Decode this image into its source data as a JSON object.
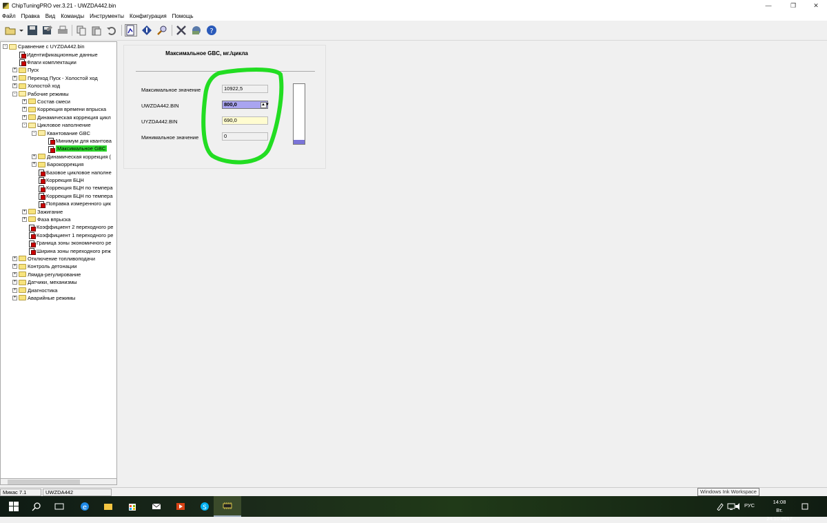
{
  "window": {
    "title": "ChipTuningPRO ver.3.21 - UWZDA442.bin"
  },
  "menu": [
    "Файл",
    "Правка",
    "Вид",
    "Команды",
    "Инструменты",
    "Конфигурация",
    "Помощь"
  ],
  "tree": {
    "nodes": [
      {
        "label": "Сравнение с UYZDA442.bin",
        "level": 0,
        "type": "folder-open",
        "expander": "-"
      },
      {
        "label": "Идентификационные данные",
        "level": 1,
        "type": "doc",
        "expander": ""
      },
      {
        "label": "Флаги комплектации",
        "level": 1,
        "type": "doc",
        "expander": ""
      },
      {
        "label": "Пуск",
        "level": 1,
        "type": "folder",
        "expander": "+"
      },
      {
        "label": "Переход Пуск - Холостой ход",
        "level": 1,
        "type": "folder",
        "expander": "+"
      },
      {
        "label": "Холостой ход",
        "level": 1,
        "type": "folder",
        "expander": "+"
      },
      {
        "label": "Рабочие режимы",
        "level": 1,
        "type": "folder-open",
        "expander": "-"
      },
      {
        "label": "Состав смеси",
        "level": 2,
        "type": "folder",
        "expander": "+"
      },
      {
        "label": "Коррекция времени впрыска",
        "level": 2,
        "type": "folder",
        "expander": "+"
      },
      {
        "label": "Динамическая коррекция цикл",
        "level": 2,
        "type": "folder",
        "expander": "+"
      },
      {
        "label": "Цикловое наполнение",
        "level": 2,
        "type": "folder-open",
        "expander": "-"
      },
      {
        "label": "Квантование GBC",
        "level": 3,
        "type": "folder-open",
        "expander": "-"
      },
      {
        "label": "Минимум для квантова",
        "level": 4,
        "type": "doc",
        "expander": ""
      },
      {
        "label": "Максимальное GBC",
        "level": 4,
        "type": "doc",
        "expander": "",
        "selected": true
      },
      {
        "label": "Динамическая коррекция (",
        "level": 3,
        "type": "folder",
        "expander": "+"
      },
      {
        "label": "Барокоррекция",
        "level": 3,
        "type": "folder",
        "expander": "+"
      },
      {
        "label": "Базовое цикловое наполне",
        "level": 3,
        "type": "doc",
        "expander": ""
      },
      {
        "label": "Коррекция БЦН",
        "level": 3,
        "type": "doc",
        "expander": ""
      },
      {
        "label": "Коррекция БЦН по темпера",
        "level": 3,
        "type": "doc",
        "expander": ""
      },
      {
        "label": "Коррекция БЦН по темпера",
        "level": 3,
        "type": "doc",
        "expander": ""
      },
      {
        "label": "Поправка измеренного цик",
        "level": 3,
        "type": "doc",
        "expander": ""
      },
      {
        "label": "Зажигание",
        "level": 2,
        "type": "folder",
        "expander": "+"
      },
      {
        "label": "Фаза впрыска",
        "level": 2,
        "type": "folder",
        "expander": "+"
      },
      {
        "label": "Коэффициент 2 переходного ре",
        "level": 2,
        "type": "doc",
        "expander": ""
      },
      {
        "label": "Коэффициент 1 переходного ре",
        "level": 2,
        "type": "doc",
        "expander": ""
      },
      {
        "label": "Граница зоны экономичного ре",
        "level": 2,
        "type": "doc",
        "expander": ""
      },
      {
        "label": "Ширина зоны переходного реж",
        "level": 2,
        "type": "doc",
        "expander": ""
      },
      {
        "label": "Отключение топливоподачи",
        "level": 1,
        "type": "folder",
        "expander": "+"
      },
      {
        "label": "Контроль детонации",
        "level": 1,
        "type": "folder",
        "expander": "+"
      },
      {
        "label": "Лямда-регулирование",
        "level": 1,
        "type": "folder",
        "expander": "+"
      },
      {
        "label": "Датчики, механизмы",
        "level": 1,
        "type": "folder",
        "expander": "+"
      },
      {
        "label": "Диагностика",
        "level": 1,
        "type": "folder",
        "expander": "+"
      },
      {
        "label": "Аварийные режимы",
        "level": 1,
        "type": "folder",
        "expander": "+"
      }
    ]
  },
  "panel": {
    "title": "Максимальное GBC, мг./цикла",
    "max_label": "Максимальное значение",
    "max_value": "10922,5",
    "uw_label": "UWZDA442.BIN",
    "uw_value": "800,0",
    "uy_label": "UYZDA442.BIN",
    "uy_value": "690,0",
    "min_label": "Минимальное значение",
    "min_value": "0",
    "gauge_fraction": 0.073,
    "highlight_color": "#22dd22"
  },
  "status": {
    "left": "Микас 7.1",
    "file": "UWZDA442"
  },
  "taskbar": {
    "tooltip": "Windows Ink Workspace",
    "lang": "РУС",
    "time": "14:08",
    "date": "Вт. 24.10.2017"
  },
  "icons": [
    "open-icon",
    "save-icon",
    "save-as-icon",
    "print-icon",
    "copy-icon",
    "paste-icon",
    "undo-icon",
    "compare-icon",
    "info-icon",
    "search-icon",
    "tools-icon",
    "map-icon",
    "help-icon"
  ]
}
